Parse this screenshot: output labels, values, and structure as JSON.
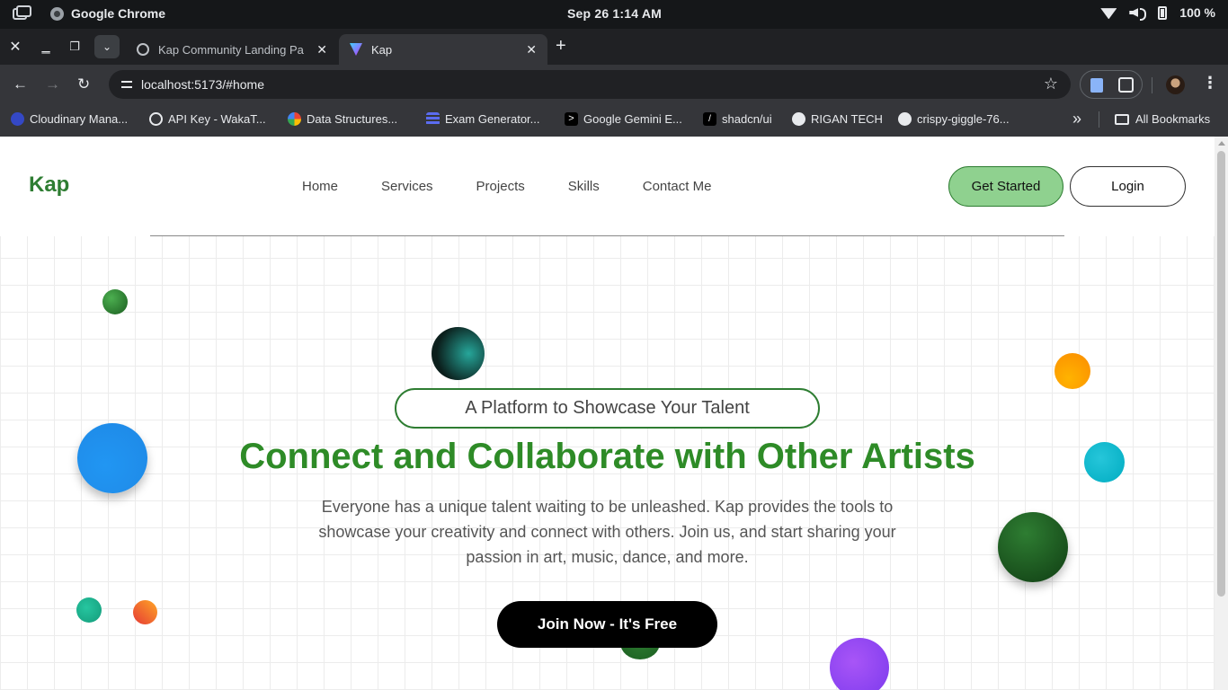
{
  "os": {
    "app_name": "Google Chrome",
    "clock": "Sep 26   1:14 AM",
    "battery": "100 %"
  },
  "browser": {
    "tabs": [
      {
        "title": "Kap Community Landing Pa",
        "active": false
      },
      {
        "title": "Kap",
        "active": true
      }
    ],
    "url": "localhost:5173/#home",
    "bookmarks": [
      {
        "label": "Cloudinary Mana...",
        "icon": "cloudinary-icon",
        "color": "#3448c5"
      },
      {
        "label": "API Key - WakaT...",
        "icon": "wakatime-icon",
        "color": "#202124"
      },
      {
        "label": "Data Structures...",
        "icon": "google-icon",
        "color": "#ffffff"
      },
      {
        "label": "Exam Generator...",
        "icon": "exam-icon",
        "color": "#5b6cf0"
      },
      {
        "label": "Google Gemini E...",
        "icon": "gemini-icon",
        "color": "#000000"
      },
      {
        "label": "shadcn/ui",
        "icon": "shadcn-icon",
        "color": "#000000"
      },
      {
        "label": "RIGAN TECH",
        "icon": "github-icon",
        "color": "#ffffff"
      },
      {
        "label": "crispy-giggle-76...",
        "icon": "github-icon",
        "color": "#ffffff"
      }
    ],
    "all_bookmarks": "All Bookmarks"
  },
  "site": {
    "logo": "Kap",
    "nav": [
      "Home",
      "Services",
      "Projects",
      "Skills",
      "Contact Me"
    ],
    "get_started": "Get Started",
    "login": "Login",
    "hero": {
      "tagline": "A Platform to Showcase Your Talent",
      "title": "Connect and Collaborate with Other Artists",
      "subtitle": "Everyone has a unique talent waiting to be unleashed. Kap provides the tools to showcase your creativity and connect with others. Join us, and start sharing your passion in art, music, dance, and more.",
      "cta": "Join Now - It's Free"
    },
    "colors": {
      "brand_green": "#2e7d32",
      "title_green": "#2e8b27",
      "button_green": "#8fd18f"
    }
  }
}
